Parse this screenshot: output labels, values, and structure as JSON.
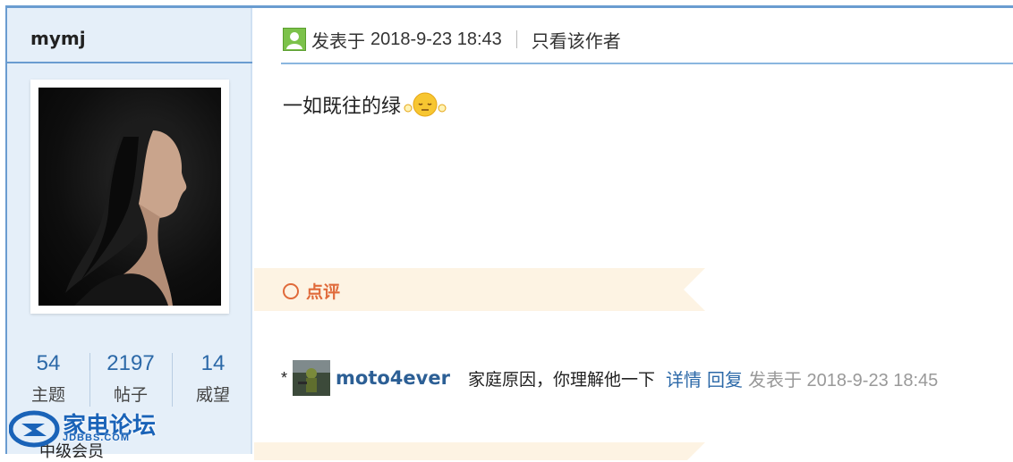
{
  "sidebar": {
    "username": "mymj",
    "stats": [
      {
        "value": "54",
        "label": "主题"
      },
      {
        "value": "2197",
        "label": "帖子"
      },
      {
        "value": "14",
        "label": "威望"
      }
    ],
    "rank": "中级会员"
  },
  "site_logo": {
    "name": "家电论坛",
    "domain": "JDBBS.COM"
  },
  "post": {
    "posted_prefix": "发表于",
    "posted_time": "2018-9-23 18:43",
    "only_author": "只看该作者",
    "content": "一如既往的绿"
  },
  "comments": {
    "title": "点评",
    "items": [
      {
        "bullet": "*",
        "user": "moto4ever",
        "text": "家庭原因，你理解他一下",
        "detail_label": "详情",
        "reply_label": "回复",
        "time": "发表于 2018-9-23 18:45"
      }
    ]
  },
  "colors": {
    "accent": "#6a9cd0",
    "link": "#2c69a8",
    "comment_accent": "#e06a3a",
    "banner": "#fdf3e3"
  }
}
